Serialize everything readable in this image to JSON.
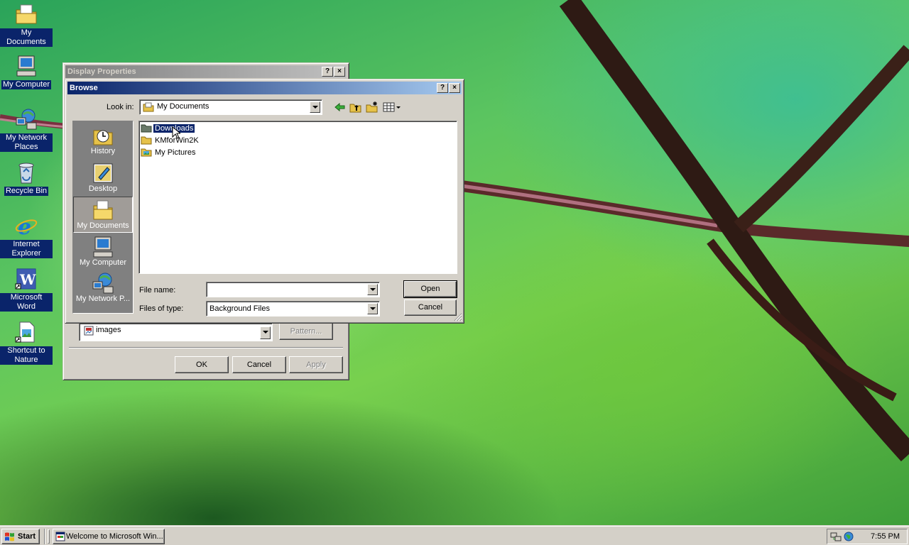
{
  "desktop": {
    "icons": [
      {
        "label": "My Documents",
        "icon": "folder-documents-icon"
      },
      {
        "label": "My Computer",
        "icon": "computer-icon"
      },
      {
        "label": "My Network Places",
        "icon": "network-icon"
      },
      {
        "label": "Recycle Bin",
        "icon": "recycle-bin-icon"
      },
      {
        "label": "Internet Explorer",
        "icon": "internet-explorer-icon"
      },
      {
        "label": "Microsoft Word",
        "icon": "word-icon"
      },
      {
        "label": "Shortcut to Nature",
        "icon": "image-shortcut-icon"
      }
    ]
  },
  "display_properties": {
    "title": "Display Properties",
    "help_label": "?",
    "close_label": "×",
    "wallpaper_value": "images",
    "pattern_label": "Pattern...",
    "ok_label": "OK",
    "cancel_label": "Cancel",
    "apply_label": "Apply"
  },
  "browse": {
    "title": "Browse",
    "help_label": "?",
    "close_label": "×",
    "look_in_label": "Look in:",
    "look_in_value": "My Documents",
    "places": [
      {
        "label": "History",
        "icon": "history-icon"
      },
      {
        "label": "Desktop",
        "icon": "desktop-icon"
      },
      {
        "label": "My Documents",
        "icon": "folder-documents-icon",
        "selected": true
      },
      {
        "label": "My Computer",
        "icon": "computer-icon"
      },
      {
        "label": "My Network P...",
        "icon": "network-icon"
      }
    ],
    "files": [
      {
        "name": "Downloads",
        "icon": "folder-icon",
        "selected": true
      },
      {
        "name": "KMforWin2K",
        "icon": "folder-icon"
      },
      {
        "name": "My Pictures",
        "icon": "pictures-folder-icon"
      }
    ],
    "file_name_label": "File name:",
    "file_name_value": "",
    "files_of_type_label": "Files of type:",
    "files_of_type_value": "Background Files",
    "open_label": "Open",
    "cancel_label": "Cancel"
  },
  "taskbar": {
    "start_label": "Start",
    "task_label": "Welcome to Microsoft Win...",
    "clock": "7:55 PM"
  },
  "colors": {
    "selection": "#0a246a",
    "face": "#d4d0c8"
  }
}
